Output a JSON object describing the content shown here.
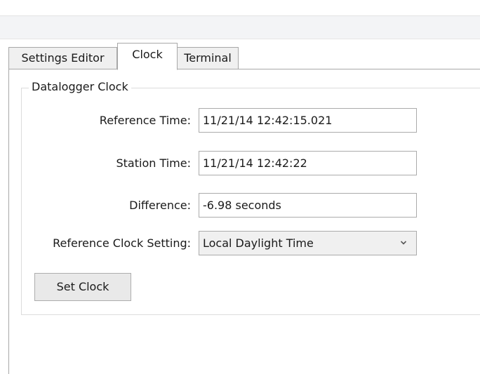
{
  "tabs": [
    {
      "label": "Settings Editor",
      "active": false
    },
    {
      "label": "Clock",
      "active": true
    },
    {
      "label": "Terminal",
      "active": false
    }
  ],
  "clock": {
    "group_title": "Datalogger Clock",
    "reference_time_label": "Reference Time:",
    "reference_time_value": "11/21/14 12:42:15.021",
    "station_time_label": "Station Time:",
    "station_time_value": "11/21/14 12:42:22",
    "difference_label": "Difference:",
    "difference_value": "-6.98 seconds",
    "reference_clock_setting_label": "Reference Clock Setting:",
    "reference_clock_setting_value": "Local Daylight Time",
    "set_clock_button": "Set Clock"
  },
  "icons": {
    "dropdown": "chevron-down-icon"
  },
  "colors": {
    "border": "#a8a8a8",
    "tab_inactive_bg": "#f0f0f0",
    "button_bg": "#e9e9e9"
  }
}
